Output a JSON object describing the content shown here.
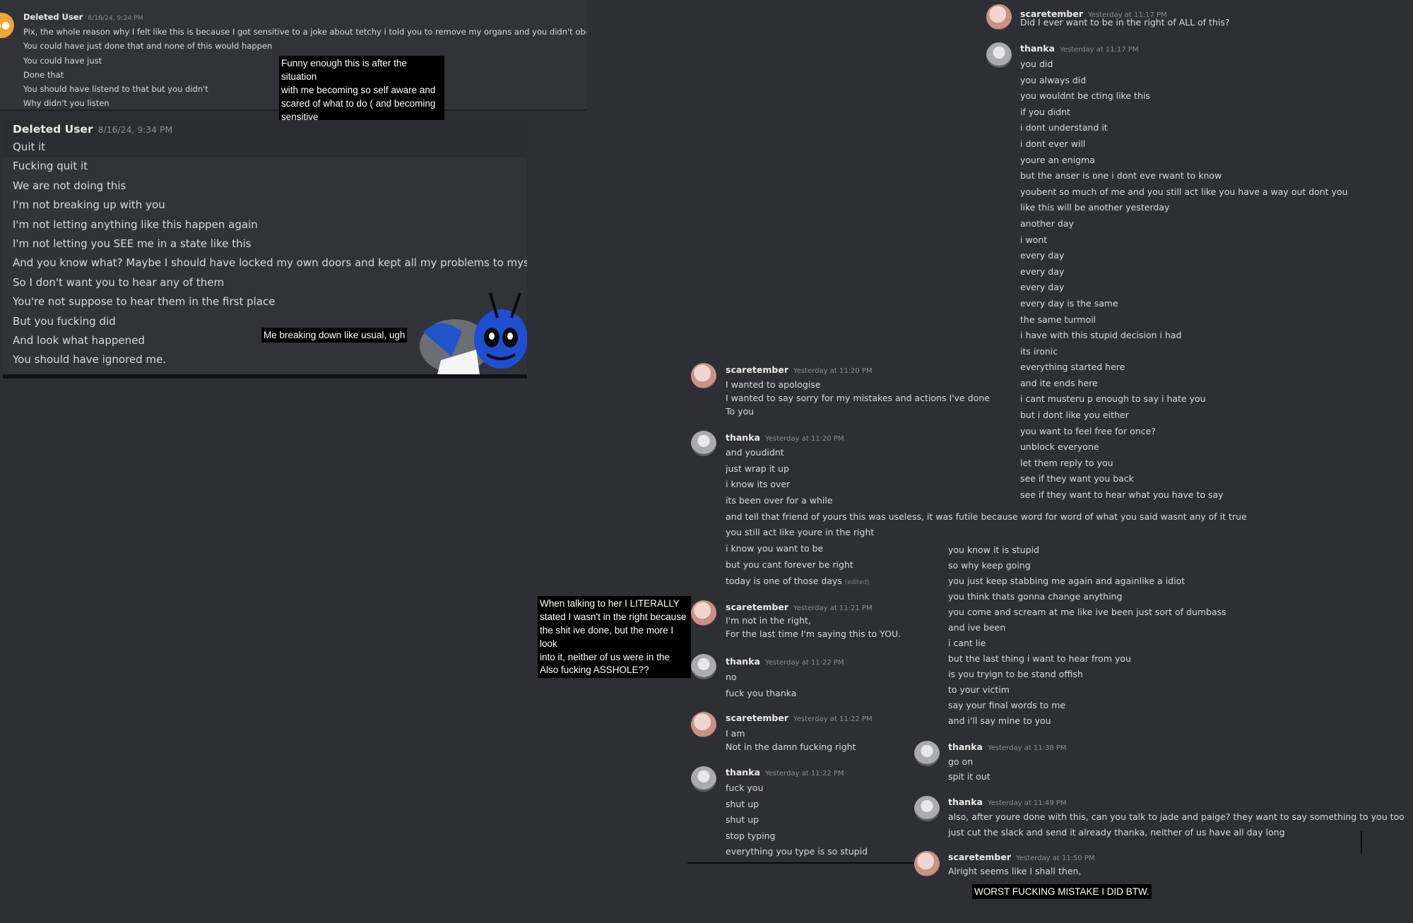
{
  "panel1": {
    "author": "Deleted User",
    "timestamp": "8/16/24, 9:24 PM",
    "lines": [
      "Pix, the whole reason why I felt like this is because I got sensitive to a joke about tetchy i told you to remove my organs and you didn't obey that order",
      "You could have just done that and none of this would happen",
      "You could have just",
      "Done that",
      "You should have listend to that but you didn't",
      "Why didn't you listen"
    ]
  },
  "caption1": "Funny enough this is after the situation\nwith me becoming so self aware and\nscared of what to do ( and becoming\nsensitive",
  "panel2": {
    "author": "Deleted User",
    "timestamp": "8/16/24, 9:34 PM",
    "lines": [
      "Quit it",
      "Fucking quit it",
      "We are not doing this",
      "I'm not breaking up with you",
      "I'm not letting anything like this happen again",
      "I'm not letting you SEE me in a state like this",
      "And you know what? Maybe I should have locked my own doors and kept all my problems to myself",
      "So I don't want you to hear any of them",
      "You're not suppose to hear them in the first place",
      "But you fucking did",
      "And look what happened",
      "You should have ignored me."
    ]
  },
  "caption2": "Me breaking down like usual, ugh",
  "caption3": "When talking to her I LITERALLY\nstated I wasn't in the right because\nthe shit ive done, but the more I look\ninto it, neither of us were in the right",
  "caption4": "Also fucking ASSHOLE??",
  "caption5": "WORST FUCKING MISTAKE I DID BTW.",
  "right_top": {
    "msg_a": {
      "author": "scaretember",
      "timestamp": "Yesterday at 11:17 PM",
      "lines": [
        "Did I ever want to be in the right of ALL of this?"
      ]
    },
    "msg_b": {
      "author": "thanka",
      "timestamp": "Yesterday at 11:17 PM",
      "lines": [
        "you did",
        "you always did",
        "you wouldnt be cting like this",
        "if you didnt",
        "i dont understand it",
        "i dont ever will",
        "youre an enigma",
        "but the anser is one i dont eve rwant to know",
        "youbent so much of me and you still act like you have a way out dont you",
        "like this will be another yesterday",
        "another day",
        "i wont",
        "every day",
        "every day",
        "every day",
        "every day is the same",
        "the same turmoil",
        "i have with this stupid decision i had",
        "its ironic",
        "everything started here",
        "and ite ends here",
        "i cant musteru p enough to say i hate you",
        "but i dont like you either",
        "you want to feel free for once?",
        "unblock everyone",
        "let them reply to you",
        "see if they want you back",
        "see if they want to hear what you have to say"
      ]
    }
  },
  "mid": {
    "m1": {
      "author": "scaretember",
      "timestamp": "Yesterday at 11:20 PM",
      "lines": [
        "I wanted to apologise",
        "I wanted to say sorry for my mistakes and actions I've done",
        "To you"
      ]
    },
    "m2": {
      "author": "thanka",
      "timestamp": "Yesterday at 11:20 PM",
      "lines": [
        "and youdidnt",
        "just wrap it up",
        "i know its over",
        "its been over for a while",
        "and tell that friend of yours this was useless, it was futile because word for word of what you said wasnt any of it true",
        "you still act like youre in the right",
        "i know you want to be",
        "but you cant forever be right",
        "today is one of those days"
      ],
      "edited": "(edited)"
    },
    "m3": {
      "author": "scaretember",
      "timestamp": "Yesterday at 11:21 PM",
      "lines": [
        "I'm not in the right,",
        "For the last time I'm saying this to YOU."
      ]
    },
    "m4": {
      "author": "thanka",
      "timestamp": "Yesterday at 11:22 PM",
      "lines": [
        "no",
        "fuck you thanka"
      ]
    },
    "m5": {
      "author": "scaretember",
      "timestamp": "Yesterday at 11:22 PM",
      "lines": [
        "I am",
        "Not in the damn fucking right"
      ]
    },
    "m6": {
      "author": "thanka",
      "timestamp": "Yesterday at 11:22 PM",
      "lines": [
        "fuck you",
        "shut up",
        "shut up",
        "stop typing",
        "everything you type is so stupid"
      ]
    }
  },
  "right_bottom": {
    "cont_lines": [
      "you know it is stupid",
      "so why keep going",
      "you just keep stabbing me again and againlike a idiot",
      "you think thats gonna change anything",
      "you come and scream at me like ive been just sort of dumbass",
      "and ive been",
      "i cant lie",
      "but the last thing i want to hear from you",
      "is you tryign to be stand offish",
      "to your victim",
      "say your final words to me",
      "and i'll say mine to you"
    ],
    "r1": {
      "author": "thanka",
      "timestamp": "Yesterday at 11:38 PM",
      "lines": [
        "go on",
        "spit it out"
      ]
    },
    "r2": {
      "author": "thanka",
      "timestamp": "Yesterday at 11:49 PM",
      "lines": [
        "also, after youre done with this, can you talk to jade and paige? they want to say something to you too",
        "just cut the slack and send it already thanka, neither of us have all day long"
      ]
    },
    "r3": {
      "author": "scaretember",
      "timestamp": "Yesterday at 11:50 PM",
      "lines": [
        "Alright seems like I shall then,"
      ]
    }
  },
  "icons": {
    "deleted_avatar": "discord-logo-icon",
    "pink_avatar": "profile-avatar-icon",
    "grey_avatar": "profile-avatar-icon"
  },
  "colors": {
    "background": "#2e2f34",
    "panel1_bg": "#313338",
    "panel2_bg": "#313338",
    "caption_bg": "#000000"
  }
}
